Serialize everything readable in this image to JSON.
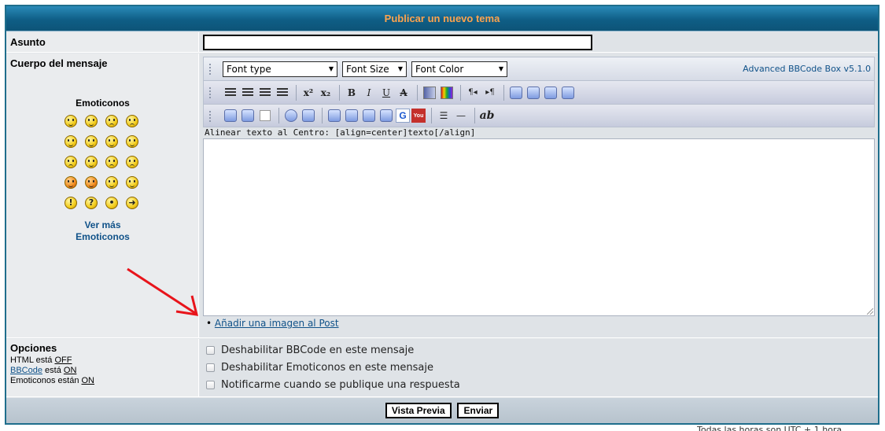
{
  "title": "Publicar un nuevo tema",
  "asunto": {
    "label": "Asunto",
    "value": ""
  },
  "cuerpo": {
    "label": "Cuerpo del mensaje"
  },
  "emoticonos": {
    "title": "Emoticonos",
    "ver_mas_1": "Ver más",
    "ver_mas_2": "Emoticonos",
    "rows": [
      [
        "very-happy-icon",
        "smile-icon",
        "sad-icon",
        "surprised-icon"
      ],
      [
        "shocked-icon",
        "confused-icon",
        "cool-icon",
        "laughing-icon"
      ],
      [
        "mad-icon",
        "razz-icon",
        "embarrassed-icon",
        "crying-icon"
      ],
      [
        "evil-icon",
        "twisted-evil-icon",
        "rolling-eyes-icon",
        "wink-icon"
      ],
      [
        "exclamation-icon",
        "question-icon",
        "idea-icon",
        "arrow-icon"
      ]
    ]
  },
  "toolbar": {
    "font_type": "Font type",
    "font_size": "Font Size",
    "font_color": "Font Color",
    "version": "Advanced BBCode Box v5.1.0",
    "sup": "x²",
    "sub": "x₂",
    "bold": "B",
    "italic": "I",
    "underline": "U",
    "strike": "A",
    "ltr": "¶◂",
    "rtl": "▸¶",
    "list": "☰",
    "hr": "—",
    "ab": "ab",
    "google": "G",
    "youtube": "You"
  },
  "hint": "Alinear texto al Centro: [align=center]texto[/align]",
  "add_image": {
    "bullet": "•",
    "link": "Añadir una imagen al Post"
  },
  "opciones": {
    "label": "Opciones",
    "html_prefix": "HTML está ",
    "html_value": "OFF",
    "bbcode_link": "BBCode",
    "bbcode_mid": " está ",
    "bbcode_value": "ON",
    "emot_prefix": "Emoticonos están ",
    "emot_value": "ON",
    "checkboxes": [
      "Deshabilitar BBCode en este mensaje",
      "Deshabilitar Emoticonos en este mensaje",
      "Notificarme cuando se publique una respuesta"
    ]
  },
  "buttons": {
    "preview": "Vista Previa",
    "submit": "Enviar"
  },
  "footer": "Todas las horas son UTC + 1 hora"
}
